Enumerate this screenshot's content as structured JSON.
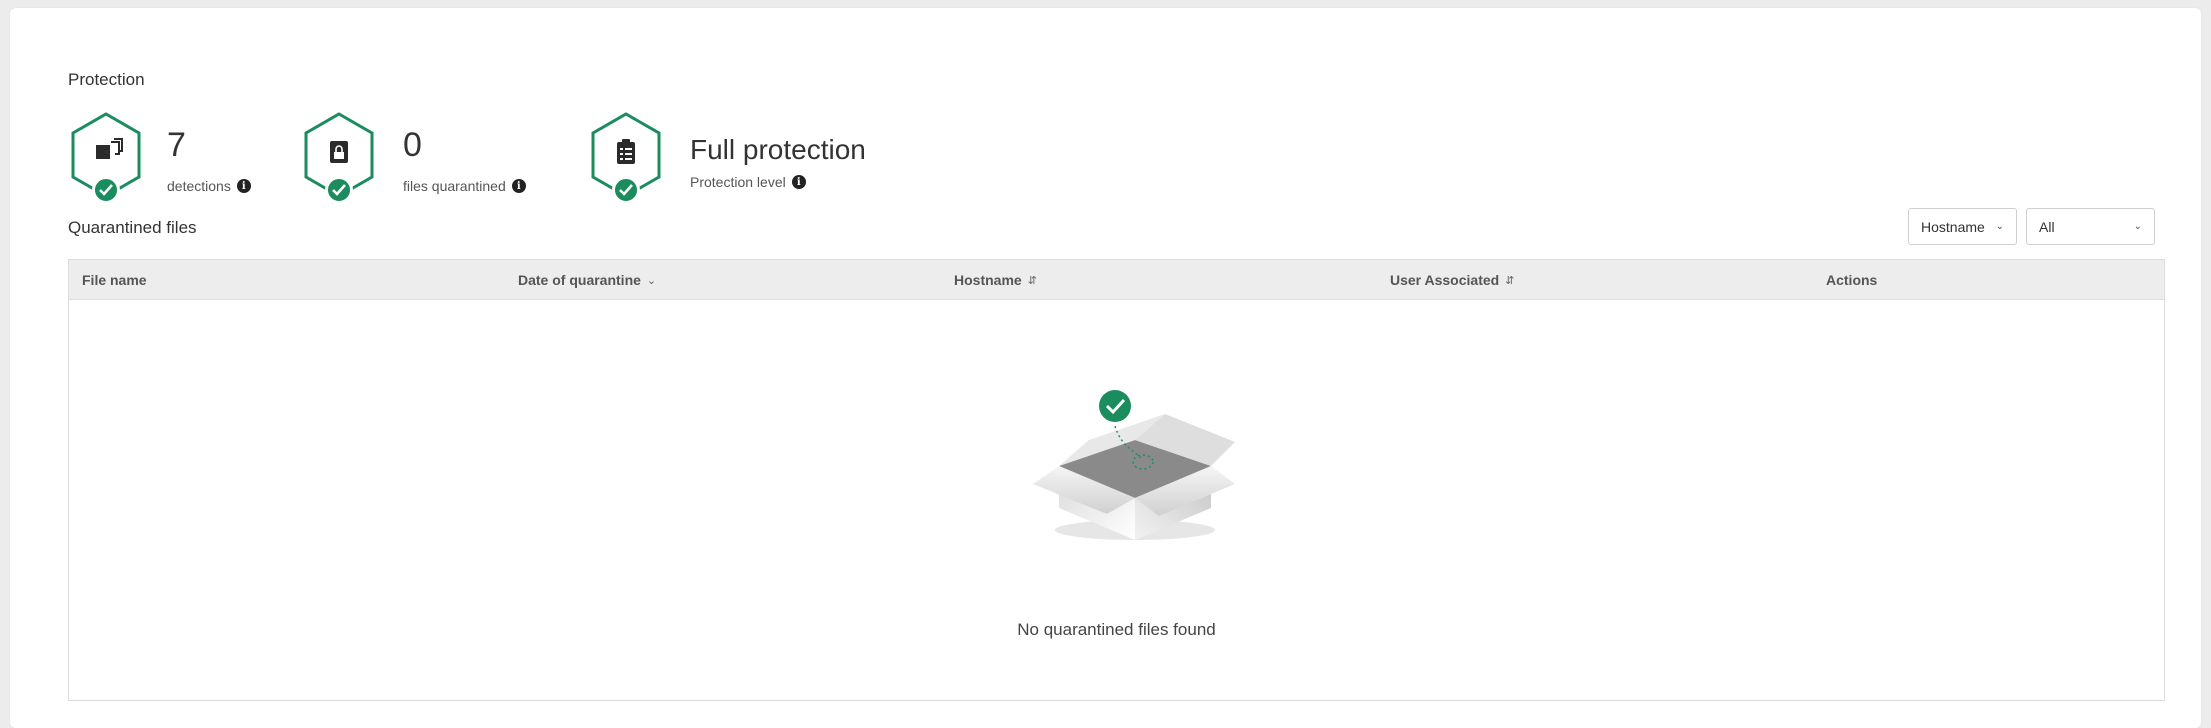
{
  "protection": {
    "title": "Protection",
    "stats": [
      {
        "value": "7",
        "label": "detections",
        "icon": "cubes-icon"
      },
      {
        "value": "0",
        "label": "files quarantined",
        "icon": "locked-file-icon"
      }
    ],
    "level": {
      "value": "Full protection",
      "label": "Protection level",
      "icon": "clipboard-list-icon"
    }
  },
  "quarantine": {
    "title": "Quarantined files",
    "filter_field": "Hostname",
    "filter_value": "All",
    "columns": [
      "File name",
      "Date of quarantine",
      "Hostname",
      "User Associated",
      "Actions"
    ],
    "empty_message": "No quarantined files found"
  },
  "colors": {
    "accent": "#1a8c5e",
    "header_bg": "#ededed",
    "page_bg": "#ececec"
  }
}
